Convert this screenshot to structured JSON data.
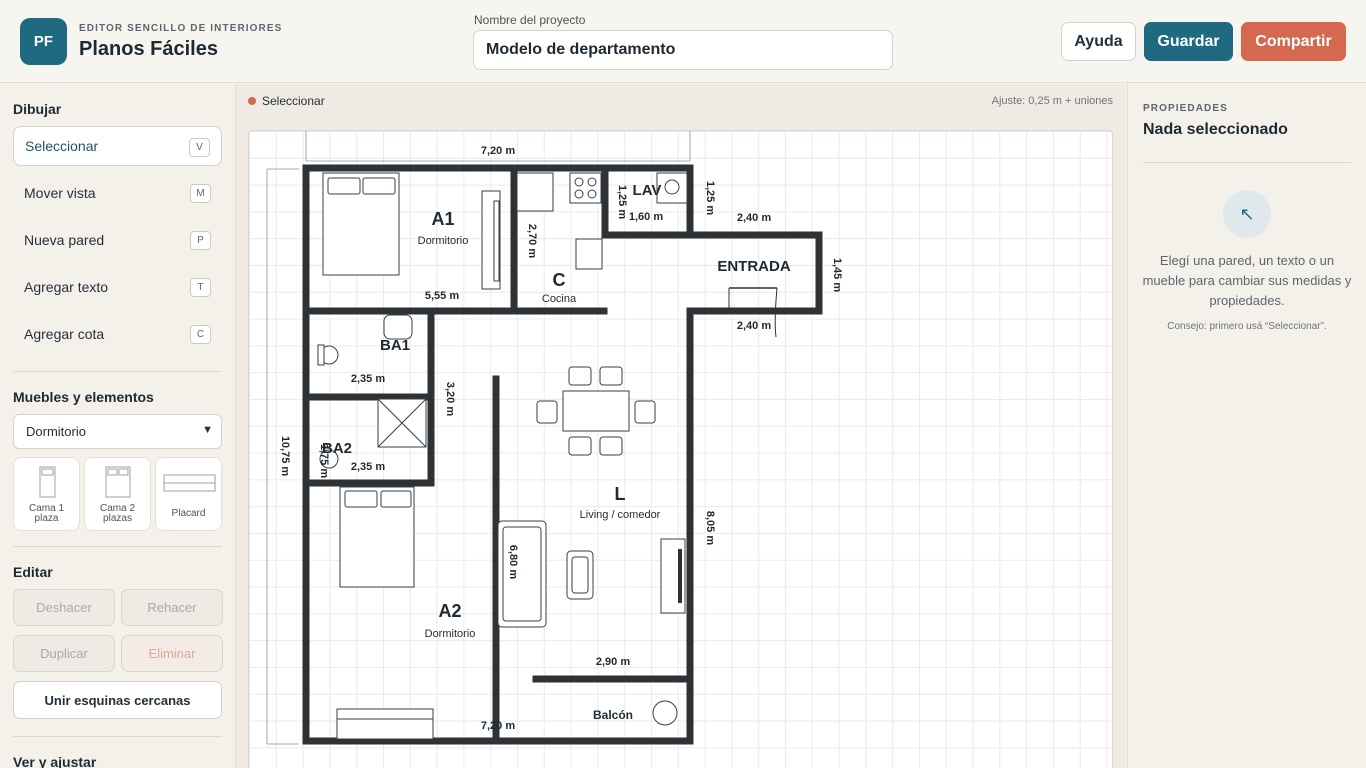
{
  "header": {
    "logo": "PF",
    "app_subtitle": "EDITOR SENCILLO DE INTERIORES",
    "app_title": "Planos Fáciles",
    "project_label": "Nombre del proyecto",
    "project_name": "Modelo de departamento",
    "help_label": "Ayuda",
    "save_label": "Guardar",
    "share_label": "Compartir"
  },
  "sidebar": {
    "draw_title": "Dibujar",
    "tools": [
      {
        "label": "Seleccionar",
        "key": "V"
      },
      {
        "label": "Mover vista",
        "key": "M"
      },
      {
        "label": "Nueva pared",
        "key": "P"
      },
      {
        "label": "Agregar texto",
        "key": "T"
      },
      {
        "label": "Agregar cota",
        "key": "C"
      }
    ],
    "furniture_title": "Muebles y elementos",
    "category_selected": "Dormitorio",
    "furniture": [
      {
        "line1": "Cama 1",
        "line2": "plaza"
      },
      {
        "line1": "Cama 2",
        "line2": "plazas"
      },
      {
        "line1": "Placard",
        "line2": ""
      }
    ],
    "edit_title": "Editar",
    "edit": {
      "undo": "Deshacer",
      "redo": "Rehacer",
      "duplicate": "Duplicar",
      "delete": "Eliminar",
      "join": "Unir esquinas cercanas"
    },
    "view_title": "Ver y ajustar"
  },
  "canvas": {
    "current_tool": "Seleccionar",
    "snap_info": "Ajuste: 0,25 m + uniones",
    "rooms": {
      "a1_code": "A1",
      "a1_name": "Dormitorio",
      "c_code": "C",
      "c_name": "Cocina",
      "lav_code": "LAV",
      "entrada": "ENTRADA",
      "ba1_code": "BA1",
      "ba2_code": "BA2",
      "l_code": "L",
      "l_name": "Living / comedor",
      "a2_code": "A2",
      "a2_name": "Dormitorio",
      "balcon": "Balcón"
    },
    "dims": {
      "top_width": "7,20 m",
      "left_height": "10,75 m",
      "a1_width": "5,55 m",
      "c_height": "2,70 m",
      "lav_left": "1,25 m",
      "lav_right": "1,25 m",
      "lav_width": "1,60 m",
      "entrada_top": "2,40 m",
      "entrada_bottom": "2,40 m",
      "entrada_side": "1,45 m",
      "ba1_width": "2,35 m",
      "ba2_width": "2,35 m",
      "ba2_side": "1,75 m",
      "ba_height": "3,20 m",
      "l_right": "8,05 m",
      "l_left": "6,80 m",
      "balcon_width": "2,90 m",
      "bottom_width": "7,20 m"
    }
  },
  "properties": {
    "label": "PROPIEDADES",
    "title": "Nada seleccionado",
    "icon": "cursor-arrow-icon",
    "help_text": "Elegí una pared, un texto o un mueble para cambiar sus medidas y propiedades.",
    "tip": "Consejo: primero usá “Seleccionar”."
  },
  "colors": {
    "brand": "#1f6a80",
    "accent": "#d4694f",
    "wall": "#2d3236"
  }
}
